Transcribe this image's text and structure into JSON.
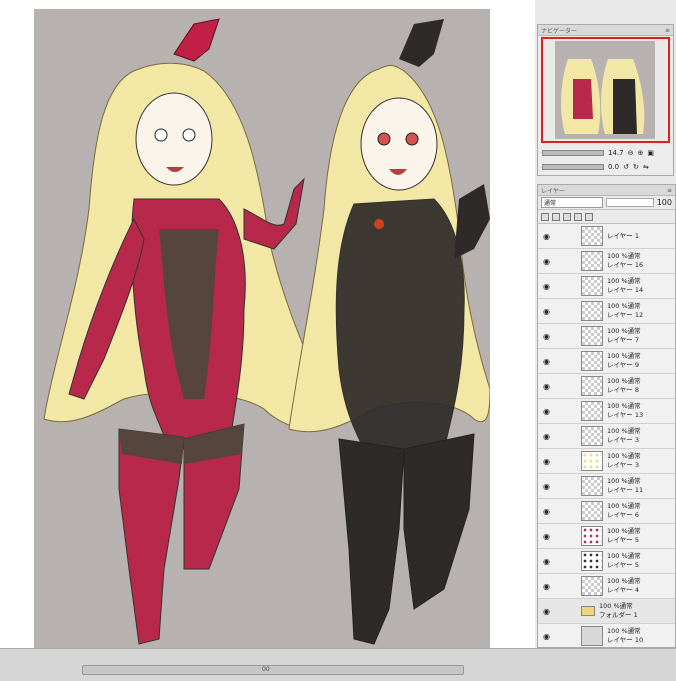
{
  "navigator": {
    "title": "ナビゲーター",
    "zoom": "14.7",
    "rotation": "0.0"
  },
  "layer_panel": {
    "title": "レイヤー",
    "blend_mode": "通常",
    "opacity": "100",
    "layers": [
      {
        "line1": "レイヤー 1",
        "line2": "",
        "thumb": "blank",
        "group": false
      },
      {
        "line1": "100 %通常",
        "line2": "レイヤー 16",
        "thumb": "blank",
        "group": false
      },
      {
        "line1": "100 %通常",
        "line2": "レイヤー 14",
        "thumb": "blank",
        "group": false
      },
      {
        "line1": "100 %通常",
        "line2": "レイヤー 12",
        "thumb": "blank",
        "group": false
      },
      {
        "line1": "100 %通常",
        "line2": "レイヤー 7",
        "thumb": "blank",
        "group": false
      },
      {
        "line1": "100 %通常",
        "line2": "レイヤー 9",
        "thumb": "blank",
        "group": false
      },
      {
        "line1": "100 %通常",
        "line2": "レイヤー 8",
        "thumb": "blank",
        "group": false
      },
      {
        "line1": "100 %通常",
        "line2": "レイヤー 13",
        "thumb": "blank",
        "group": false
      },
      {
        "line1": "100 %通常",
        "line2": "レイヤー 3",
        "thumb": "blank",
        "group": false
      },
      {
        "line1": "100 %通常",
        "line2": "レイヤー 3",
        "thumb": "skin",
        "group": false
      },
      {
        "line1": "100 %通常",
        "line2": "レイヤー 11",
        "thumb": "blank",
        "group": false
      },
      {
        "line1": "100 %通常",
        "line2": "レイヤー 6",
        "thumb": "blank",
        "group": false
      },
      {
        "line1": "100 %通常",
        "line2": "レイヤー 5",
        "thumb": "red",
        "group": false
      },
      {
        "line1": "100 %通常",
        "line2": "レイヤー 5",
        "thumb": "dark",
        "group": false
      },
      {
        "line1": "100 %通常",
        "line2": "レイヤー 4",
        "thumb": "blank",
        "group": false
      },
      {
        "line1": "100 %通常",
        "line2": "フォルダー 1",
        "thumb": "folder",
        "group": true
      },
      {
        "line1": "100 %通常",
        "line2": "レイヤー 10",
        "thumb": "paper",
        "group": false
      }
    ]
  },
  "status": {
    "zoom_indicator": "00"
  },
  "colors": {
    "canvas_bg": "#b7b2b0",
    "hair": "#f3e7a6",
    "suit_red": "#b8284a",
    "suit_dark": "#55453d",
    "black_outfit": "#2e2a29",
    "ribbon_red": "#c21f47"
  }
}
